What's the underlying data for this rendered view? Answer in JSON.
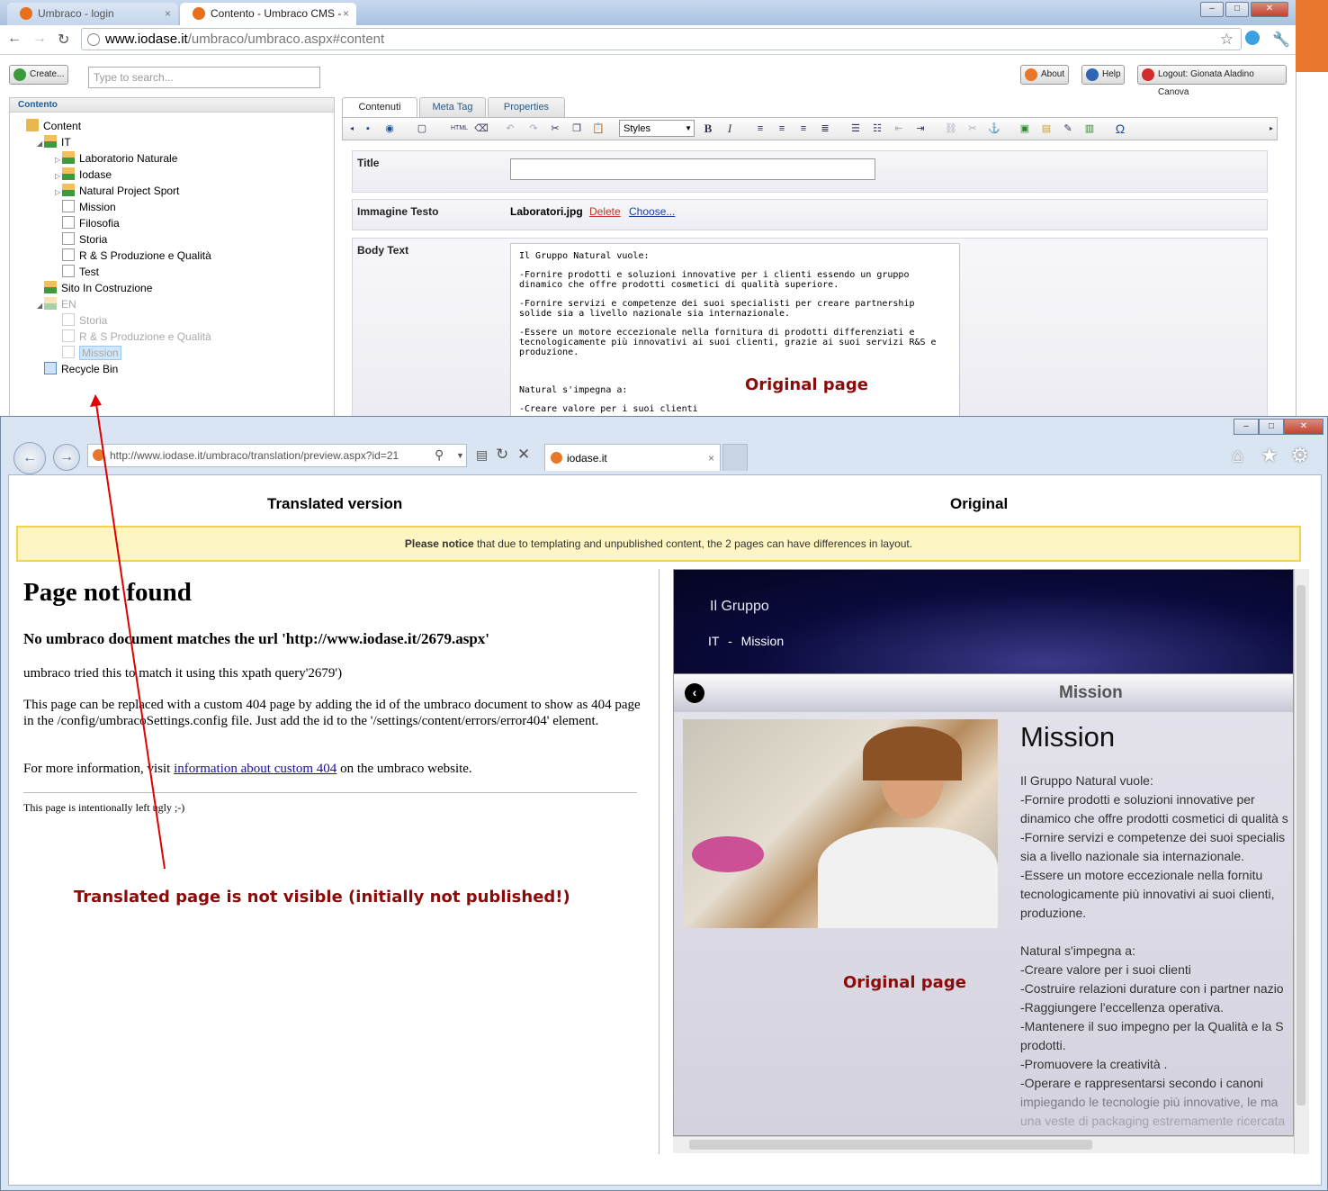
{
  "chrome": {
    "tabs": [
      {
        "label": "Umbraco - login",
        "close": "×"
      },
      {
        "label": "Contento - Umbraco CMS -",
        "close": "×"
      }
    ],
    "url_host": "www.iodase.it",
    "url_path": "/umbraco/umbraco.aspx#content",
    "window_buttons": {
      "min": "–",
      "max": "□",
      "close": "✕"
    }
  },
  "umbraco": {
    "create_label": "Create...",
    "search_placeholder": "Type to search...",
    "about_label": "About",
    "help_label": "Help",
    "logout_label": "Logout: Gionata Aladino Canova",
    "tree_header": "Contento",
    "tree": [
      {
        "label": "Content",
        "level": 0,
        "icon": "folder-icon",
        "toggle": "",
        "dim": false
      },
      {
        "label": "IT",
        "level": 1,
        "icon": "home-icon",
        "toggle": "◢",
        "dim": false
      },
      {
        "label": "Laboratorio Naturale",
        "level": 2,
        "icon": "home-icon",
        "toggle": "▷",
        "dim": false
      },
      {
        "label": "Iodase",
        "level": 2,
        "icon": "home-icon",
        "toggle": "▷",
        "dim": false
      },
      {
        "label": "Natural Project Sport",
        "level": 2,
        "icon": "home-icon",
        "toggle": "▷",
        "dim": false
      },
      {
        "label": "Mission",
        "level": 2,
        "icon": "document-icon",
        "toggle": "",
        "dim": false
      },
      {
        "label": "Filosofia",
        "level": 2,
        "icon": "document-icon",
        "toggle": "",
        "dim": false
      },
      {
        "label": "Storia",
        "level": 2,
        "icon": "document-icon",
        "toggle": "",
        "dim": false
      },
      {
        "label": "R & S Produzione e Qualità",
        "level": 2,
        "icon": "document-icon",
        "toggle": "",
        "dim": false
      },
      {
        "label": "Test",
        "level": 2,
        "icon": "document-icon",
        "toggle": "",
        "dim": false
      },
      {
        "label": "Sito In Costruzione",
        "level": 1,
        "icon": "home-icon",
        "toggle": "",
        "dim": false
      },
      {
        "label": "EN",
        "level": 1,
        "icon": "home-icon",
        "toggle": "◢",
        "dim": true
      },
      {
        "label": "Storia",
        "level": 2,
        "icon": "document-icon",
        "toggle": "",
        "dim": true
      },
      {
        "label": "R & S Produzione e Qualità",
        "level": 2,
        "icon": "document-icon",
        "toggle": "",
        "dim": true
      },
      {
        "label": "Mission",
        "level": 2,
        "icon": "document-icon",
        "toggle": "",
        "dim": true,
        "selected": true
      },
      {
        "label": "Recycle Bin",
        "level": 1,
        "icon": "recycle-bin-icon",
        "toggle": "",
        "dim": false
      }
    ],
    "editor_tabs": [
      "Contenuti",
      "Meta Tag",
      "Properties"
    ],
    "styles_select": "Styles",
    "title_label": "Title",
    "image_label": "Immagine Testo",
    "image_file": "Laboratori.jpg",
    "image_delete": "Delete",
    "image_choose": "Choose...",
    "body_label": "Body Text",
    "body_paragraphs": [
      "Il Gruppo Natural vuole:",
      "-Fornire prodotti e soluzioni innovative per i clienti essendo un gruppo dinamico che offre prodotti cosmetici di qualità superiore.",
      "-Fornire servizi e competenze dei suoi specialisti per creare partnership solide sia a livello nazionale sia internazionale.",
      "-Essere un motore eccezionale nella fornitura di prodotti differenziati e tecnologicamente più innovativi ai suoi clienti, grazie ai suoi servizi R&S e produzione.",
      "",
      "Natural s'impegna a:",
      "-Creare valore per i suoi clienti"
    ]
  },
  "annotations": {
    "original_top": "Original page",
    "translated_bottom": "Translated page is not visible (initially not published!)",
    "original_bottom": "Original page"
  },
  "ie": {
    "address": "http://www.iodase.it/umbraco/translation/preview.aspx?id=21",
    "tab_label": "iodase.it",
    "tab_close": "×",
    "window_buttons": {
      "min": "–",
      "max": "□",
      "close": "✕"
    }
  },
  "preview": {
    "translated_heading": "Translated version",
    "original_heading": "Original",
    "notice_bold": "Please notice",
    "notice_rest": " that due to templating and unpublished content, the 2 pages can have differences in layout.",
    "error_title": "Page not found",
    "error_subtitle": "No umbraco document matches the url 'http://www.iodase.it/2679.aspx'",
    "error_p1": "umbraco tried this to match it using this xpath query'2679')",
    "error_p2": "This page can be replaced with a custom 404 page by adding the id of the umbraco document to show as 404 page in the /config/umbracoSettings.config file. Just add the id to the '/settings/content/errors/error404' element.",
    "error_p3_pre": "For more information, visit ",
    "error_p3_link": "information about custom 404",
    "error_p3_post": " on the umbraco website.",
    "error_footer": "This page is intentionally left ugly ;-)"
  },
  "original_site": {
    "hero_title": "Il Gruppo",
    "breadcrumb_it": "IT",
    "breadcrumb_sep": "-",
    "breadcrumb_page": "Mission",
    "bar_title": "Mission",
    "page_title": "Mission",
    "lines": [
      "Il Gruppo Natural vuole:",
      "-Fornire prodotti e soluzioni innovative per",
      "dinamico che offre prodotti cosmetici di qualità s",
      "-Fornire servizi e competenze dei suoi specialis",
      "sia a livello nazionale sia internazionale.",
      "-Essere un motore eccezionale nella fornitu",
      "tecnologicamente più innovativi ai suoi clienti,",
      "produzione.",
      "",
      "Natural s'impegna a:",
      "-Creare valore per i suoi clienti",
      "-Costruire relazioni durature con i partner nazio",
      "-Raggiungere l'eccellenza operativa.",
      "-Mantenere il suo impegno per la Qualità e la S",
      "prodotti.",
      "-Promuovere la creatività .",
      "-Operare e rappresentarsi secondo i canoni",
      "impiegando le tecnologie più innovative, le ma",
      "una veste di packaging estremamente ricercata"
    ]
  },
  "colors": {
    "annotation": "#8b0a0a",
    "umbraco_orange": "#e8762b",
    "notice_bg": "#fdf6c4",
    "link": "#1a0dab"
  }
}
